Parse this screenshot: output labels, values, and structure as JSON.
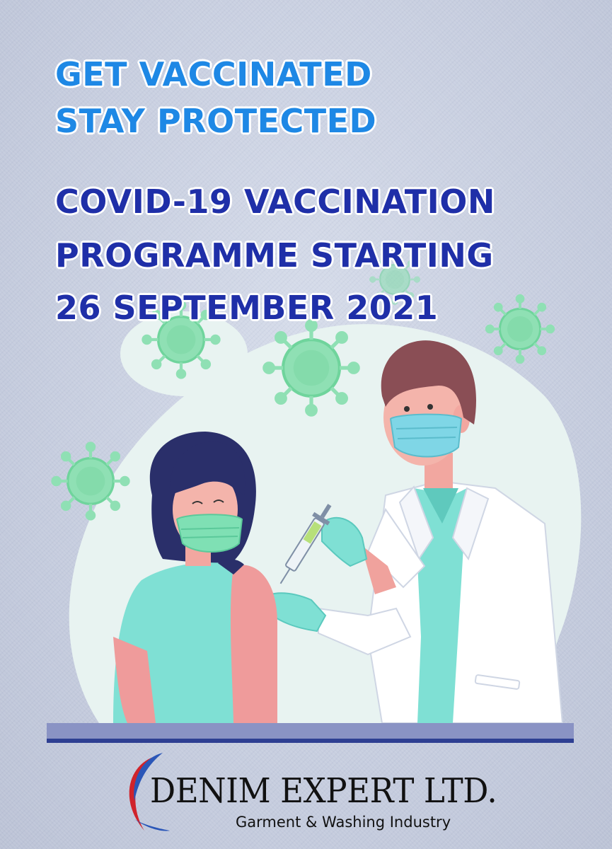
{
  "headline": {
    "line1": "GET VACCINATED",
    "line2": "STAY PROTECTED",
    "line3": "COVID-19 VACCINATION",
    "line4": "PROGRAMME STARTING",
    "line5": "26 SEPTEMBER 2021"
  },
  "brand": {
    "name": "DENIM EXPERT LTD.",
    "tagline": "Garment & Washing Industry"
  },
  "colors": {
    "headline_light": "#1e88e5",
    "headline_dark": "#1f2fa8",
    "virus": "#8fe0b4",
    "scrubs": "#7fe0d4",
    "logo_red": "#d0232b",
    "logo_blue": "#2a56b8"
  },
  "icons": [
    "virus-icon",
    "doctor-illustration",
    "patient-illustration",
    "syringe-icon",
    "logo-swoosh-icon"
  ]
}
